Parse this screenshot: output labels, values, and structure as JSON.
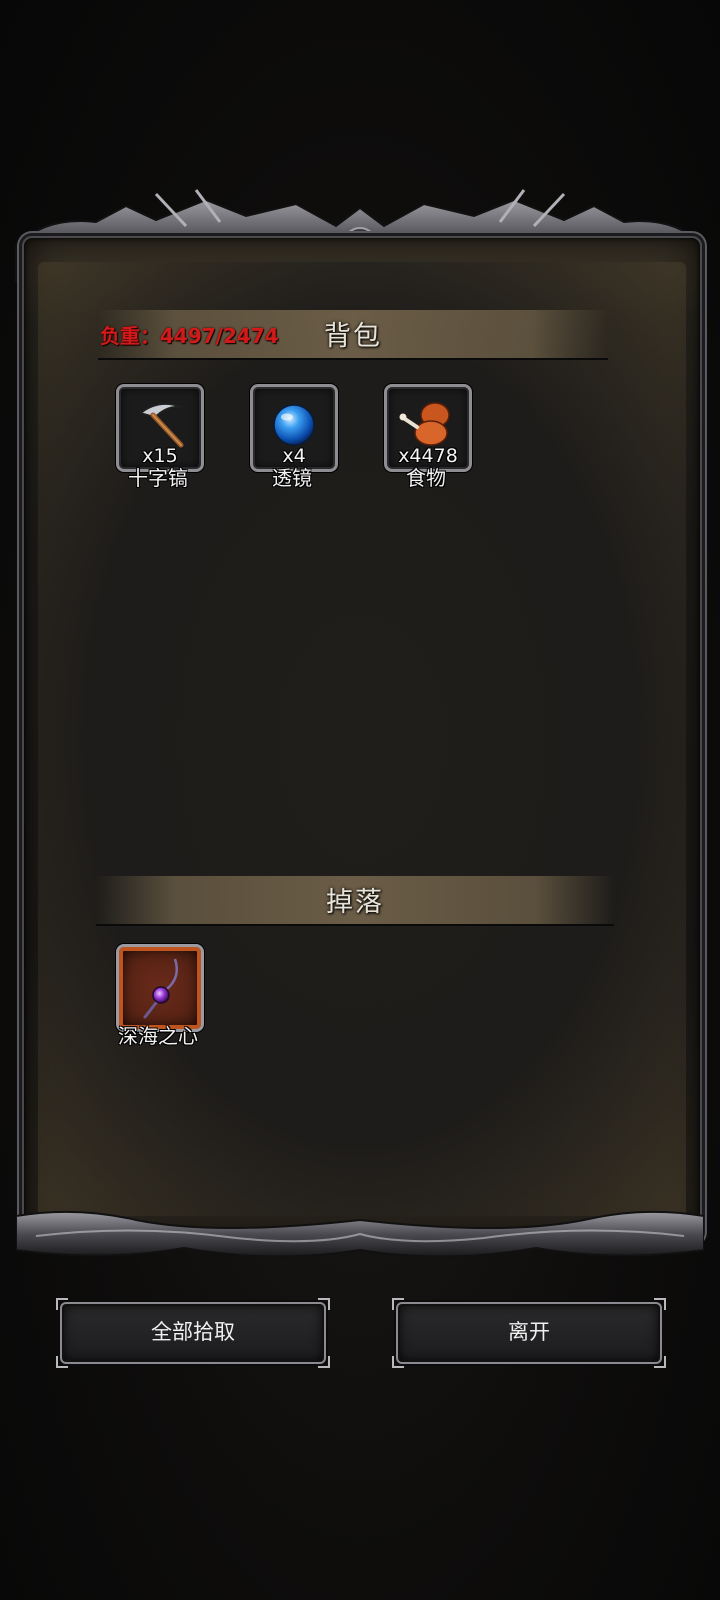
{
  "backpack": {
    "weight_text": "负重：4497/2474",
    "weight_color": "#d11a1a",
    "title": "背包",
    "items": [
      {
        "icon": "pickaxe-icon",
        "qty": "x15",
        "name": "十字镐"
      },
      {
        "icon": "lens-orb-icon",
        "qty": "x4",
        "name": "透镜"
      },
      {
        "icon": "food-drumstick-icon",
        "qty": "x4478",
        "name": "食物"
      }
    ]
  },
  "drops": {
    "title": "掉落",
    "items": [
      {
        "icon": "amulet-icon",
        "name": "深海之心",
        "rarity_color": "#c0541f"
      }
    ]
  },
  "buttons": {
    "pickup_all": "全部拾取",
    "leave": "离开"
  }
}
